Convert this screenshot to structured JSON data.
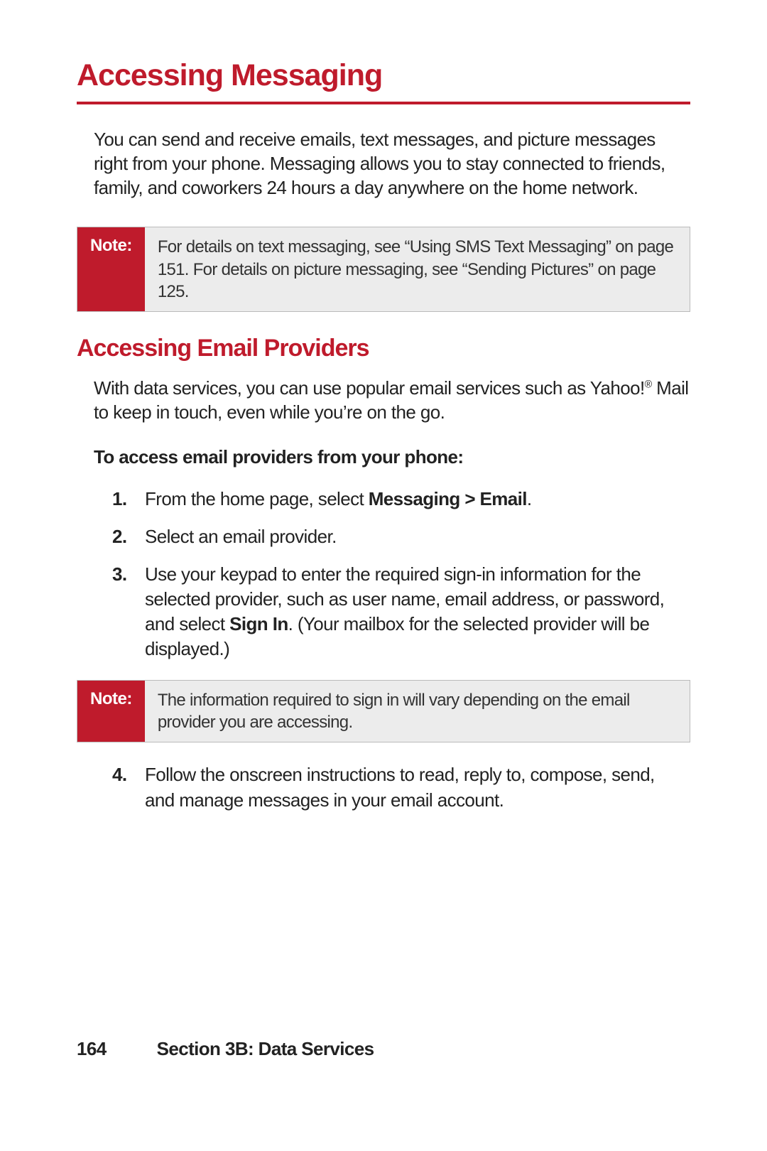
{
  "h1": "Accessing Messaging",
  "intro": "You can send and receive emails, text messages, and picture messages right from your phone. Messaging allows you to stay connected to friends, family, and coworkers 24 hours a day anywhere on the home network.",
  "note1": {
    "label": "Note:",
    "text": "For details on text messaging, see “Using SMS Text Messaging” on page 151. For details on picture messaging, see “Sending Pictures” on page 125."
  },
  "h2": "Accessing Email Providers",
  "desc_pre": "With data services, you can use popular email services such as Yahoo!",
  "desc_sup": "®",
  "desc_post": " Mail to keep in touch, even while you’re on the go.",
  "subhead": "To access email providers from your phone:",
  "steps": {
    "s1": {
      "num": "1.",
      "pre": "From the home page, select ",
      "bold": "Messaging > Email",
      "post": "."
    },
    "s2": {
      "num": "2.",
      "text": "Select an email provider."
    },
    "s3": {
      "num": "3.",
      "pre": "Use your keypad to enter the required sign-in information for the selected provider, such as user name, email address, or password, and select ",
      "bold": "Sign In",
      "post": ". (Your mailbox for the selected provider will be displayed.)"
    },
    "s4": {
      "num": "4.",
      "text": "Follow the onscreen instructions to read, reply to, compose, send, and manage messages in your email account."
    }
  },
  "note2": {
    "label": "Note:",
    "text": "The information required to sign in will vary depending on the email provider you are accessing."
  },
  "footer": {
    "page_number": "164",
    "section": "Section 3B: Data Services"
  }
}
